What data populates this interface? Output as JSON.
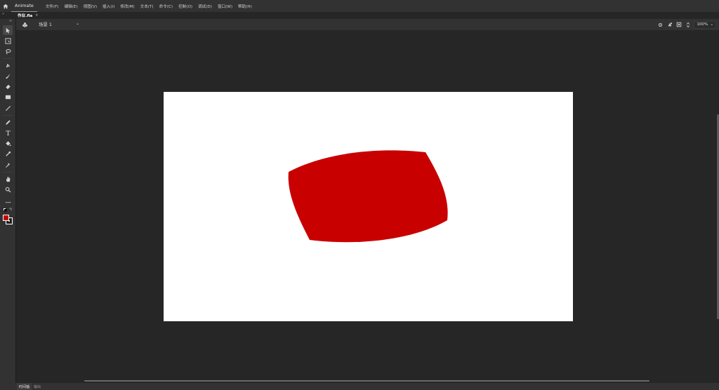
{
  "app": {
    "name": "Animate",
    "home_icon": "home-icon"
  },
  "menu": {
    "items": [
      "文件(F)",
      "编辑(E)",
      "视图(V)",
      "插入(I)",
      "修改(M)",
      "文本(T)",
      "命令(C)",
      "控制(O)",
      "调试(D)",
      "窗口(W)",
      "帮助(H)"
    ]
  },
  "document": {
    "tab_label": "作业.fla",
    "close_glyph": "×",
    "expand_glyph": "»"
  },
  "scene": {
    "label": "场景 1",
    "chevron": "⌄",
    "zoom": "100%",
    "right_icons": [
      "snap-icon",
      "color-effect-icon",
      "clip-stage-icon",
      "zoom-stepper-icon"
    ]
  },
  "tools": [
    "selection-tool",
    "free-transform-tool",
    "lasso-tool",
    "pen-tool",
    "brush-tool",
    "eraser-tool",
    "rectangle-tool",
    "line-tool",
    "pencil-tool",
    "text-tool",
    "paint-bucket-tool",
    "eyedropper-tool",
    "pin-tool",
    "hand-tool",
    "zoom-tool",
    "more-tools"
  ],
  "colors": {
    "stroke": "#000000",
    "fill": "#c80000",
    "shape_fill": "#c80000",
    "stage_bg": "#ffffff"
  },
  "bottom_tabs": [
    "时间轴",
    "输出"
  ]
}
